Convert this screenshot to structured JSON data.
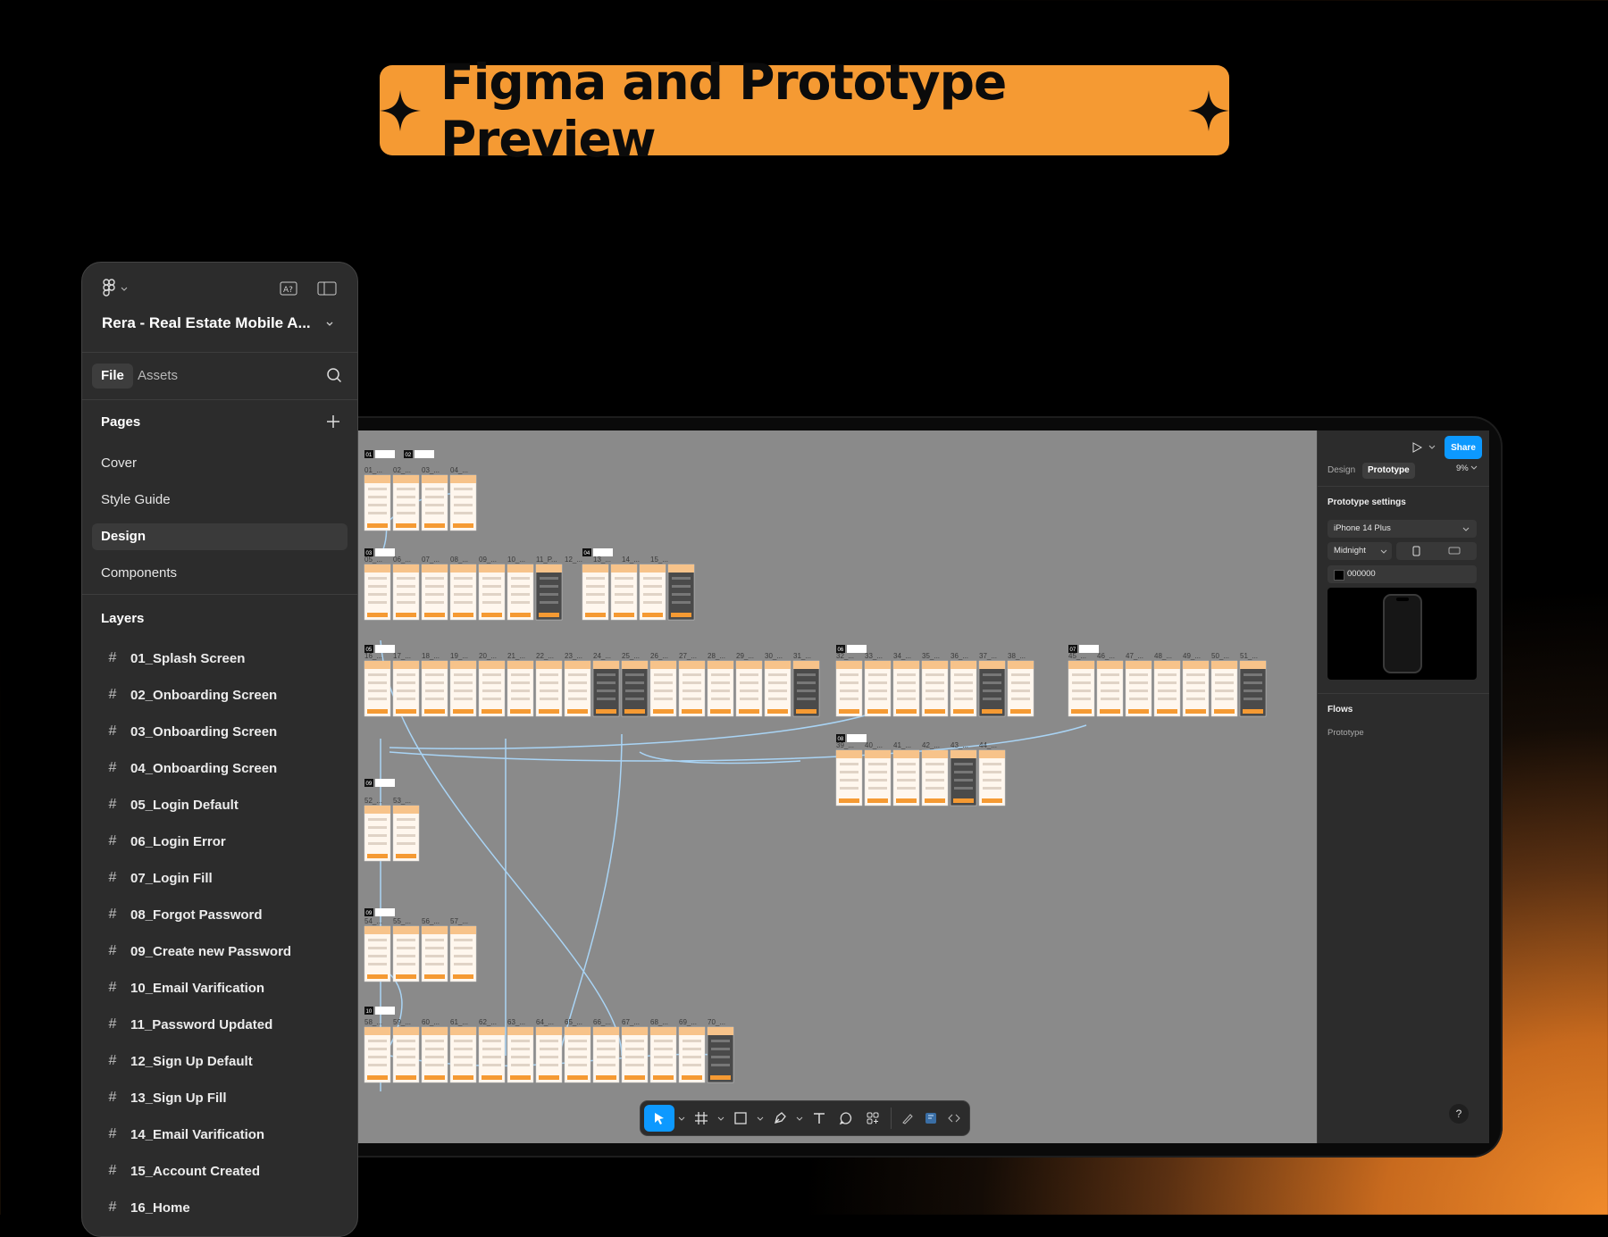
{
  "banner": {
    "title": "Figma and Prototype Preview"
  },
  "left_panel": {
    "file_name": "Rera - Real Estate Mobile A...",
    "tabs": [
      "File",
      "Assets"
    ],
    "pages_title": "Pages",
    "pages": [
      "Cover",
      "Style Guide",
      "Design",
      "Components"
    ],
    "selected_page": "Design",
    "layers_title": "Layers",
    "layers": [
      "01_Splash Screen",
      "02_Onboarding Screen",
      "03_Onboarding Screen",
      "04_Onboarding Screen",
      "05_Login Default",
      "06_Login Error",
      "07_Login Fill",
      "08_Forgot Password",
      "09_Create new Password",
      "10_Email Varification",
      "11_Password Updated",
      "12_Sign Up Default",
      "13_Sign Up Fill",
      "14_Email Varification",
      "15_Account Created",
      "16_Home"
    ]
  },
  "right_panel": {
    "share_label": "Share",
    "tabs": [
      "Design",
      "Prototype"
    ],
    "zoom": "9%",
    "prototype_settings_title": "Prototype settings",
    "device": "iPhone 14 Plus",
    "model_color": "Midnight",
    "background_hex": "000000",
    "flows_title": "Flows",
    "flow_name": "Prototype",
    "help": "?"
  },
  "canvas": {
    "section_tags": [
      "01",
      "02",
      "03",
      "04",
      "05",
      "06",
      "07",
      "08",
      "09",
      "10"
    ],
    "row1_numbers": [
      "01_...",
      "02_...",
      "03_...",
      "04_..."
    ],
    "row2_numbers": [
      "05_...",
      "06_...",
      "07_...",
      "08_...",
      "09_...",
      "10_...",
      "11_P...",
      "12_...",
      "13_...",
      "14_...",
      "15_..."
    ],
    "row3_numbers": [
      "16_...",
      "17_...",
      "18_...",
      "19_...",
      "20_...",
      "21_...",
      "22_...",
      "23_...",
      "24_...",
      "25_...",
      "26_...",
      "27_...",
      "28_...",
      "29_...",
      "30_...",
      "31_..."
    ],
    "row3b_numbers": [
      "32_...",
      "33_...",
      "34_...",
      "35_...",
      "36_...",
      "37_...",
      "38_..."
    ],
    "row3c_numbers": [
      "45_...",
      "46_...",
      "47_...",
      "48_...",
      "49_...",
      "50_...",
      "51_..."
    ],
    "row4_numbers": [
      "39_...",
      "40_...",
      "41_...",
      "42_...",
      "43_...",
      "44_..."
    ],
    "row5_numbers": [
      "52_...",
      "53_..."
    ],
    "row6_numbers": [
      "54_...",
      "55_...",
      "56_...",
      "57_..."
    ],
    "row7_numbers": [
      "58_...",
      "59_...",
      "60_...",
      "61_...",
      "62_...",
      "63_...",
      "64_...",
      "65_...",
      "66_...",
      "67_...",
      "68_...",
      "69_...",
      "70_..."
    ]
  },
  "colors": {
    "accent_orange": "#f59a33",
    "figma_blue": "#0d99ff",
    "panel_bg": "#2c2c2c",
    "canvas_bg": "#8a8a8a",
    "connector": "#a9d4f5"
  },
  "icons": {
    "banner": "sparkle-icon",
    "toolbar": [
      "move-icon",
      "frame-icon",
      "rectangle-icon",
      "pen-icon",
      "text-icon",
      "comment-icon",
      "components-icon",
      "draw-icon",
      "design-mode-icon",
      "dev-mode-icon"
    ]
  }
}
